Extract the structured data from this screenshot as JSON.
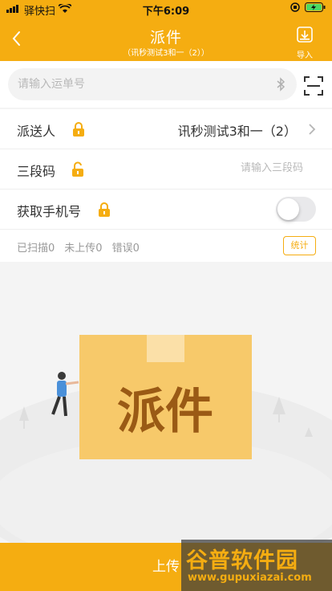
{
  "status_bar": {
    "carrier": "驿快扫",
    "time": "下午6:09"
  },
  "nav": {
    "title": "派件",
    "subtitle": "（讯秒测试3和一（2））",
    "import_label": "导入"
  },
  "scan": {
    "placeholder": "请输入运单号"
  },
  "form": {
    "courier": {
      "label": "派送人",
      "value": "讯秒测试3和一（2）"
    },
    "code": {
      "label": "三段码",
      "placeholder": "请输入三段码"
    },
    "phone": {
      "label": "获取手机号",
      "toggle_on": false
    }
  },
  "stats": {
    "scanned": "已扫描0",
    "not_uploaded": "未上传0",
    "errors": "错误0",
    "button": "统计"
  },
  "illustration": {
    "box_text": "派件"
  },
  "footer": {
    "upload_label": "上传"
  },
  "watermark": {
    "name": "谷普软件园",
    "url": "www.gupuxiazai.com"
  },
  "colors": {
    "accent": "#f5ad11",
    "box": "#f7c96a",
    "box_text": "#9a5a15"
  }
}
